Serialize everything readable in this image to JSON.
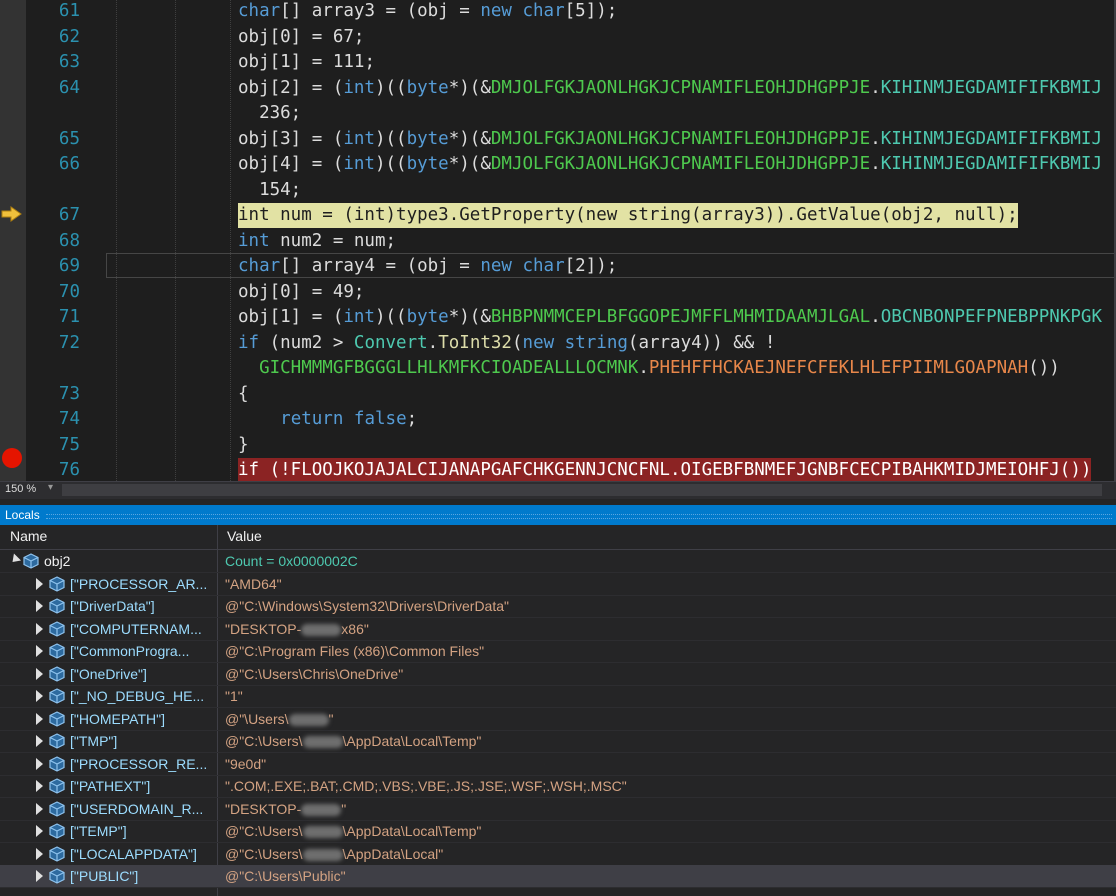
{
  "editor": {
    "zoom": "150 %",
    "lines": [
      {
        "n": "61",
        "tokens": [
          [
            "kw",
            "char"
          ],
          [
            "",
            "[] array3 = (obj = "
          ],
          [
            "kw",
            "new"
          ],
          [
            "",
            ""
          ],
          [
            "kw",
            " char"
          ],
          [
            "",
            "[5]);"
          ]
        ]
      },
      {
        "n": "62",
        "tokens": [
          [
            "",
            "obj[0] = "
          ],
          [
            "num",
            "67"
          ],
          [
            "",
            ";"
          ]
        ]
      },
      {
        "n": "63",
        "tokens": [
          [
            "",
            "obj[1] = "
          ],
          [
            "num",
            "111"
          ],
          [
            "",
            ";"
          ]
        ]
      },
      {
        "n": "64",
        "tokens": [
          [
            "",
            "obj[2] = ("
          ],
          [
            "kw",
            "int"
          ],
          [
            "",
            ")(("
          ],
          [
            "kw",
            "byte"
          ],
          [
            "",
            "*)(&"
          ],
          [
            "grn",
            "DMJOLFGKJAONLHGKJCPNAMIFLEOHJDHGPPJE"
          ],
          [
            "",
            "."
          ],
          [
            "cls",
            "KIHINMJEGDAMIFIFKBMIJ"
          ]
        ]
      },
      {
        "n": "",
        "tokens": [
          [
            "",
            "  236;"
          ]
        ]
      },
      {
        "n": "65",
        "tokens": [
          [
            "",
            "obj[3] = ("
          ],
          [
            "kw",
            "int"
          ],
          [
            "",
            ")(("
          ],
          [
            "kw",
            "byte"
          ],
          [
            "",
            "*)(&"
          ],
          [
            "grn",
            "DMJOLFGKJAONLHGKJCPNAMIFLEOHJDHGPPJE"
          ],
          [
            "",
            "."
          ],
          [
            "cls",
            "KIHINMJEGDAMIFIFKBMIJ"
          ]
        ]
      },
      {
        "n": "66",
        "tokens": [
          [
            "",
            "obj[4] = ("
          ],
          [
            "kw",
            "int"
          ],
          [
            "",
            ")(("
          ],
          [
            "kw",
            "byte"
          ],
          [
            "",
            "*)(&"
          ],
          [
            "grn",
            "DMJOLFGKJAONLHGKJCPNAMIFLEOHJDHGPPJE"
          ],
          [
            "",
            "."
          ],
          [
            "cls",
            "KIHINMJEGDAMIFIFKBMIJ"
          ]
        ]
      },
      {
        "n": "",
        "tokens": [
          [
            "",
            "  154;"
          ]
        ]
      },
      {
        "n": "67",
        "tokens": [
          [
            "",
            "int num = (int)type3.GetProperty(new string(array3)).GetValue(obj2, null);"
          ]
        ]
      },
      {
        "n": "68",
        "tokens": [
          [
            "kw",
            "int"
          ],
          [
            "",
            " num2 = num;"
          ]
        ]
      },
      {
        "n": "69",
        "tokens": [
          [
            "kw",
            "char"
          ],
          [
            "",
            "[] array4 = (obj = "
          ],
          [
            "kw",
            "new"
          ],
          [
            "kw",
            " char"
          ],
          [
            "",
            "[2]);"
          ]
        ]
      },
      {
        "n": "70",
        "tokens": [
          [
            "",
            "obj[0] = 49;"
          ]
        ]
      },
      {
        "n": "71",
        "tokens": [
          [
            "",
            "obj[1] = ("
          ],
          [
            "kw",
            "int"
          ],
          [
            "",
            ")(("
          ],
          [
            "kw",
            "byte"
          ],
          [
            "",
            "*)(&"
          ],
          [
            "grn",
            "BHBPNMMCEPLBFGGOPEJMFFLMHMIDAAMJLGAL"
          ],
          [
            "",
            "."
          ],
          [
            "cls",
            "OBCNBONPEFPNEBPPNKPGK"
          ]
        ]
      },
      {
        "n": "72",
        "tokens": [
          [
            "kw",
            "if"
          ],
          [
            "",
            " (num2 > "
          ],
          [
            "cls",
            "Convert"
          ],
          [
            "",
            "."
          ],
          [
            "fn",
            "ToInt32"
          ],
          [
            "",
            "("
          ],
          [
            "kw",
            "new"
          ],
          [
            "kw",
            " string"
          ],
          [
            "",
            "(array4)) && !"
          ]
        ]
      },
      {
        "n": "",
        "tokens": [
          [
            "",
            "  "
          ],
          [
            "grn",
            "GICHMMMGFBGGGLLHLKMFKCIOADEALLLOCMNK"
          ],
          [
            "",
            "."
          ],
          [
            "orange",
            "PHEHFFHCKAEJNEFCFEKLHLEFPIIMLGOAPNAH"
          ],
          [
            "",
            "())"
          ]
        ]
      },
      {
        "n": "73",
        "tokens": [
          [
            "",
            "{"
          ]
        ]
      },
      {
        "n": "74",
        "tokens": [
          [
            "",
            "    "
          ],
          [
            "kw",
            "return"
          ],
          [
            "",
            " "
          ],
          [
            "kw",
            "false"
          ],
          [
            "",
            ";"
          ]
        ]
      },
      {
        "n": "75",
        "tokens": [
          [
            "",
            "}"
          ]
        ]
      },
      {
        "n": "76",
        "tokens": [
          [
            "",
            "if (!FLOOJKOJAJALCIJANAPGAFCHKGENNJCNCFNL.OIGEBFBNMEFJGNBFCECPIBAHKMIDJMEIOHFJ())"
          ]
        ]
      },
      {
        "n": "77",
        "tokens": [
          [
            "",
            "{"
          ]
        ]
      }
    ]
  },
  "locals": {
    "title": "Locals",
    "col_name": "Name",
    "col_value": "Value",
    "root": {
      "name": "obj2",
      "value": "Count = 0x0000002C"
    },
    "items": [
      {
        "name": "[\"PROCESSOR_AR...",
        "value": "\"AMD64\""
      },
      {
        "name": "[\"DriverData\"]",
        "value": "@\"C:\\Windows\\System32\\Drivers\\DriverData\""
      },
      {
        "name": "[\"COMPUTERNAM...",
        "value": "\"DESKTOP-"
      },
      {
        "name": "[\"CommonProgra...",
        "value": "@\"C:\\Program Files (x86)\\Common Files\""
      },
      {
        "name": "[\"OneDrive\"]",
        "value": "@\"C:\\Users\\Chris\\OneDrive\""
      },
      {
        "name": "[\"_NO_DEBUG_HE...",
        "value": "\"1\""
      },
      {
        "name": "[\"HOMEPATH\"]",
        "value": "@\"\\Users\\"
      },
      {
        "name": "[\"TMP\"]",
        "value": "@\"C:\\Users\\"
      },
      {
        "name": "[\"PROCESSOR_RE...",
        "value": "\"9e0d\""
      },
      {
        "name": "[\"PATHEXT\"]",
        "value": "\".COM;.EXE;.BAT;.CMD;.VBS;.VBE;.JS;.JSE;.WSF;.WSH;.MSC\""
      },
      {
        "name": "[\"USERDOMAIN_R...",
        "value": "\"DESKTOP-"
      },
      {
        "name": "[\"TEMP\"]",
        "value": "@\"C:\\Users\\"
      },
      {
        "name": "[\"LOCALAPPDATA\"]",
        "value": "@\"C:\\Users\\"
      },
      {
        "name": "[\"PUBLIC\"]",
        "value": "@\"C:\\Users\\Public\""
      }
    ],
    "suffixes": {
      "2": "x86\"",
      "6": "\"",
      "7": "\\AppData\\Local\\Temp\"",
      "10": "\"",
      "11": "\\AppData\\Local\\Temp\"",
      "12": "\\AppData\\Local\""
    }
  },
  "colors": {
    "accent": "#007acc",
    "breakpoint": "#e51400",
    "current_line": "#e2e2a4"
  }
}
